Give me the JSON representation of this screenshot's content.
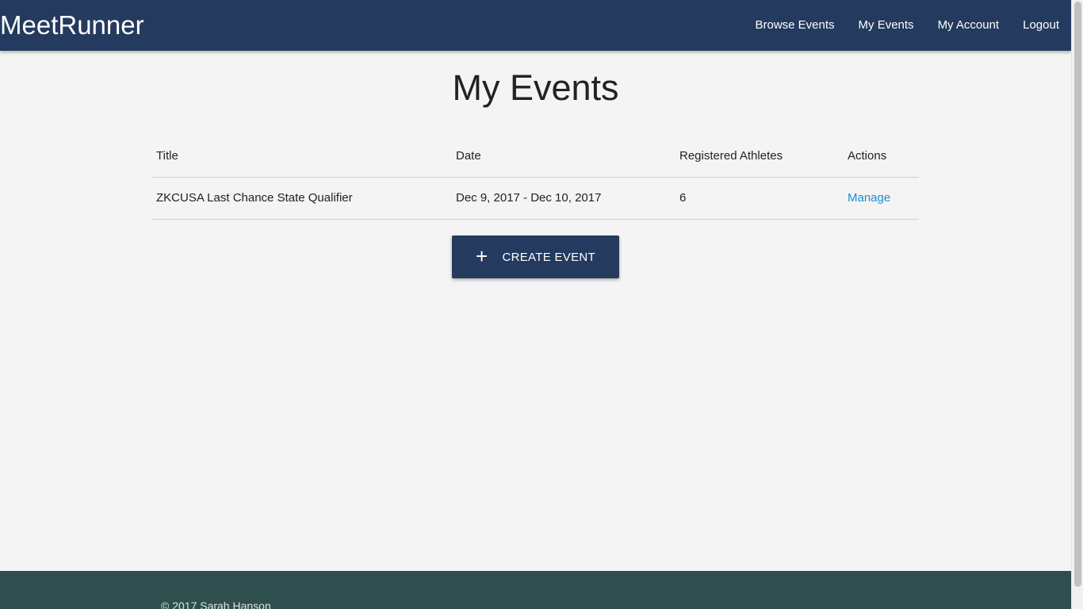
{
  "navbar": {
    "brand": "MeetRunner",
    "links": [
      {
        "label": "Browse Events"
      },
      {
        "label": "My Events"
      },
      {
        "label": "My Account"
      },
      {
        "label": "Logout"
      }
    ]
  },
  "page": {
    "title": "My Events"
  },
  "table": {
    "headers": {
      "title": "Title",
      "date": "Date",
      "athletes": "Registered Athletes",
      "actions": "Actions"
    },
    "rows": [
      {
        "title": "ZKCUSA Last Chance State Qualifier",
        "date": "Dec 9, 2017 - Dec 10, 2017",
        "athletes": "6",
        "action": "Manage"
      }
    ]
  },
  "create_button": {
    "icon": "plus-icon",
    "label": "CREATE EVENT"
  },
  "footer": {
    "copyright": "© 2017 Sarah Hanson"
  },
  "colors": {
    "navbar": "#243a5e",
    "footer": "#2f4f4f",
    "link": "#1b8fd0",
    "background": "#f4f4f4"
  }
}
